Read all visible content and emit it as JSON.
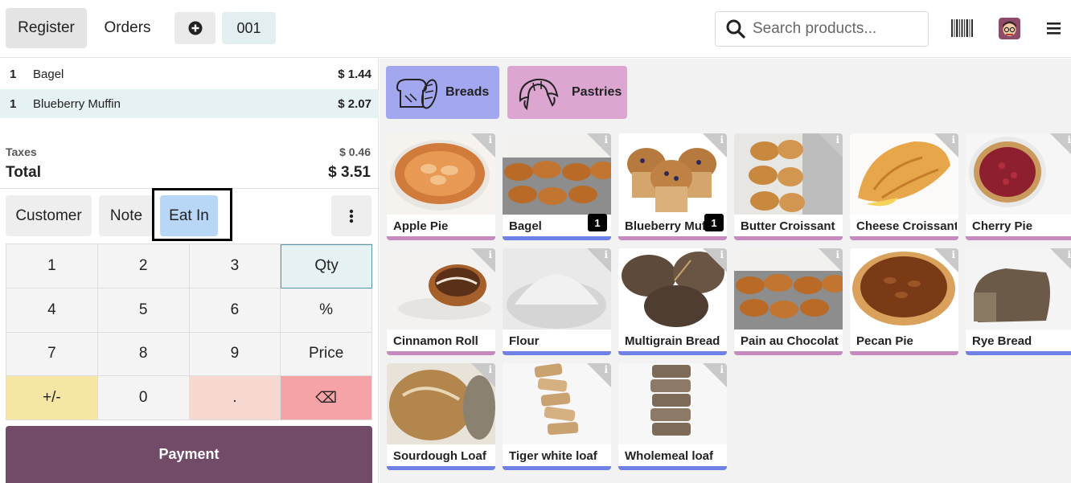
{
  "header": {
    "register_label": "Register",
    "orders_label": "Orders",
    "order_number": "001",
    "search_placeholder": "Search products..."
  },
  "order": {
    "lines": [
      {
        "qty": "1",
        "name": "Bagel",
        "price": "$ 1.44"
      },
      {
        "qty": "1",
        "name": "Blueberry Muffin",
        "price": "$ 2.07"
      }
    ],
    "taxes_label": "Taxes",
    "taxes_value": "$ 0.46",
    "total_label": "Total",
    "total_value": "$ 3.51"
  },
  "actions": {
    "customer": "Customer",
    "note": "Note",
    "eat_in": "Eat In"
  },
  "keypad": {
    "k1": "1",
    "k2": "2",
    "k3": "3",
    "qty": "Qty",
    "k4": "4",
    "k5": "5",
    "k6": "6",
    "pct": "%",
    "k7": "7",
    "k8": "8",
    "k9": "9",
    "price": "Price",
    "sign": "+/-",
    "k0": "0",
    "dot": ".",
    "back": "⌫"
  },
  "payment_label": "Payment",
  "categories": [
    {
      "label": "Breads",
      "color": "#a3a7ef"
    },
    {
      "label": "Pastries",
      "color": "#dca6d1"
    }
  ],
  "colors": {
    "bread_bar": "#6f81e6",
    "pastry_bar": "#c68abf",
    "payment": "#714b67"
  },
  "products": [
    {
      "name": "Apple Pie",
      "qty": ""
    },
    {
      "name": "Bagel",
      "qty": "1"
    },
    {
      "name": "Blueberry Muffin",
      "qty": "1"
    },
    {
      "name": "Butter Croissant",
      "qty": ""
    },
    {
      "name": "Cheese Croissant",
      "qty": ""
    },
    {
      "name": "Cherry Pie",
      "qty": ""
    },
    {
      "name": "Cinnamon Roll",
      "qty": ""
    },
    {
      "name": "Flour",
      "qty": ""
    },
    {
      "name": "Multigrain Bread",
      "qty": ""
    },
    {
      "name": "Pain au Chocolat",
      "qty": ""
    },
    {
      "name": "Pecan Pie",
      "qty": ""
    },
    {
      "name": "Rye Bread",
      "qty": ""
    },
    {
      "name": "Sourdough Loaf",
      "qty": ""
    },
    {
      "name": "Tiger white loaf",
      "qty": ""
    },
    {
      "name": "Wholemeal loaf",
      "qty": ""
    }
  ],
  "icons": [
    "plus-circle-icon",
    "search-icon",
    "barcode-icon",
    "avatar",
    "hamburger-menu-icon",
    "kebab-menu-icon",
    "info-icon",
    "bread-icon",
    "croissant-icon"
  ]
}
